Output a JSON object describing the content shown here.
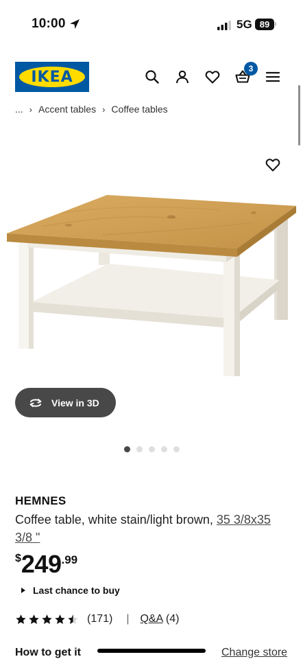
{
  "status_bar": {
    "time": "10:00",
    "network": "5G",
    "battery": "89"
  },
  "header": {
    "logo_text": "IKEA",
    "cart_count": "3",
    "icons": [
      "search-icon",
      "account-icon",
      "heart-icon",
      "cart-icon",
      "menu-icon"
    ],
    "brand_blue": "#0058a3",
    "brand_yellow": "#ffdb00"
  },
  "breadcrumb": {
    "ellipsis": "...",
    "items": [
      "Accent tables",
      "Coffee tables"
    ]
  },
  "gallery": {
    "view3d_label": "View in 3D",
    "total_images": 5,
    "active_index": 0
  },
  "product": {
    "name": "HEMNES",
    "description": "Coffee table, white stain/light brown, ",
    "dimensions": "35 3/8x35 3/8 \"",
    "price_currency": "$",
    "price_main": "249",
    "price_cents": ".99",
    "availability": "Last chance to buy",
    "rating_value": 4.5,
    "rating_count": "(171)",
    "rating_separator": "|",
    "qa_label": "Q&A",
    "qa_count": " (4)"
  },
  "delivery": {
    "how_to_get": "How to get it",
    "change_store": "Change store"
  }
}
